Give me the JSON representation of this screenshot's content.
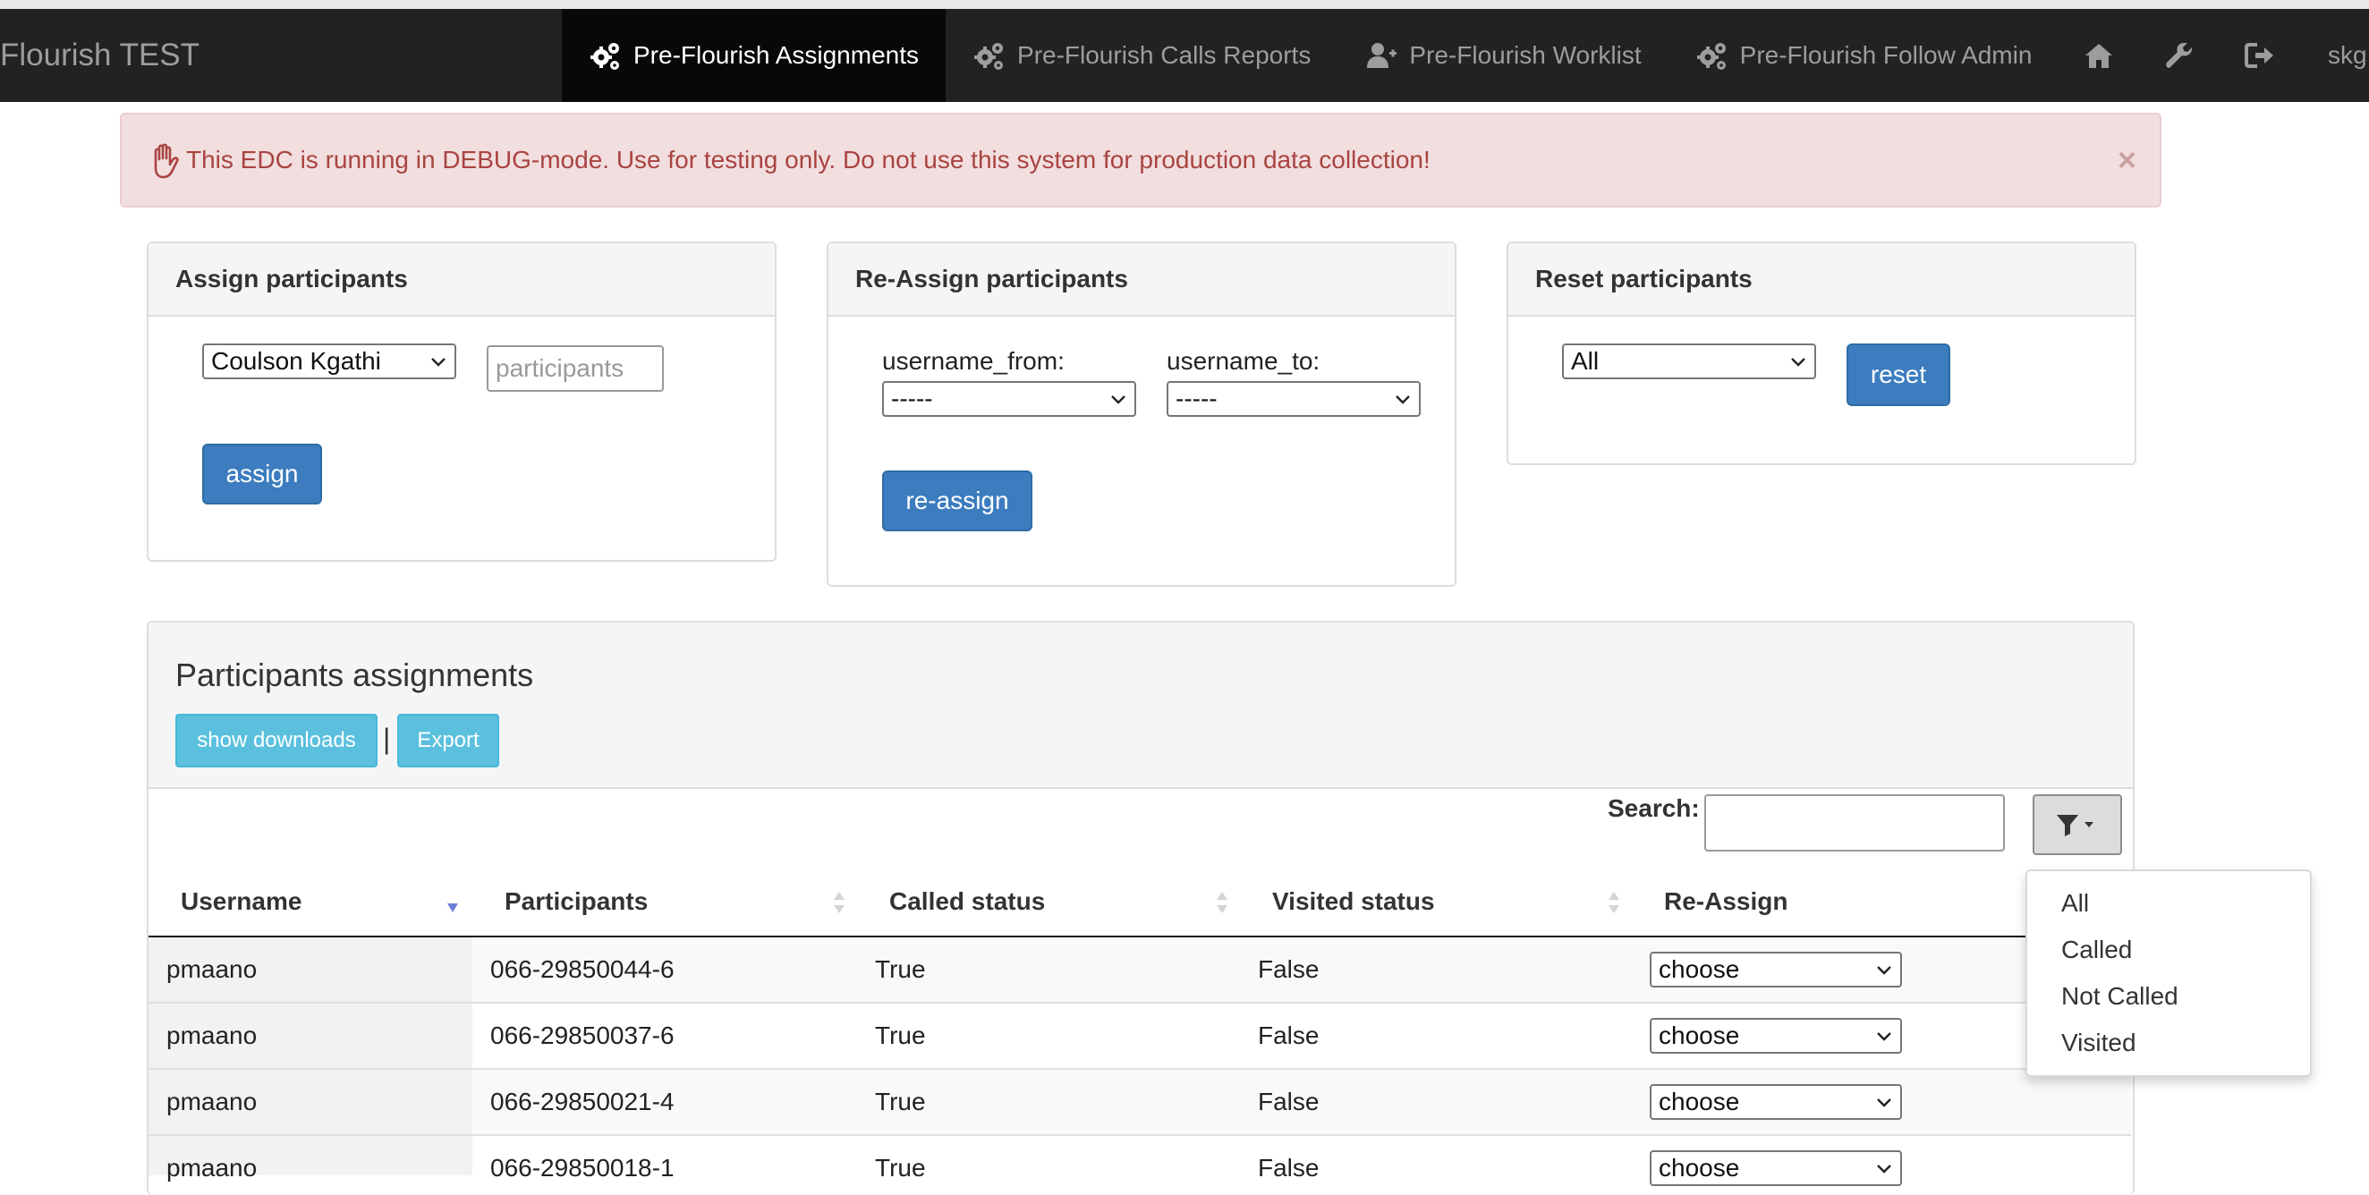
{
  "brand": "Flourish TEST",
  "nav": {
    "items": [
      {
        "label": "Pre-Flourish Assignments",
        "icon": "gears-icon"
      },
      {
        "label": "Pre-Flourish Calls Reports",
        "icon": "gears-icon"
      },
      {
        "label": "Pre-Flourish Worklist",
        "icon": "user-plus-icon"
      },
      {
        "label": "Pre-Flourish Follow Admin",
        "icon": "gears-icon"
      }
    ],
    "user": "skg"
  },
  "alert": {
    "text": "This EDC is running in DEBUG-mode. Use for testing only. Do not use this system for production data collection!",
    "close": "×"
  },
  "assign": {
    "title": "Assign participants",
    "user_select": "Coulson Kgathi",
    "participants_placeholder": "participants",
    "button": "assign"
  },
  "reassign": {
    "title": "Re-Assign participants",
    "from_label": "username_from:",
    "to_label": "username_to:",
    "from_value": "-----",
    "to_value": "-----",
    "button": "re-assign"
  },
  "reset": {
    "title": "Reset participants",
    "select_value": "All",
    "button": "reset"
  },
  "assignments": {
    "title": "Participants assignments",
    "show_downloads": "show downloads",
    "separator": "|",
    "export": "Export",
    "search_label": "Search:",
    "columns": [
      "Username",
      "Participants",
      "Called status",
      "Visited status",
      "Re-Assign"
    ],
    "rows": [
      {
        "username": "pmaano",
        "participant": "066-29850044-6",
        "called": "True",
        "visited": "False",
        "reassign": "choose"
      },
      {
        "username": "pmaano",
        "participant": "066-29850037-6",
        "called": "True",
        "visited": "False",
        "reassign": "choose"
      },
      {
        "username": "pmaano",
        "participant": "066-29850021-4",
        "called": "True",
        "visited": "False",
        "reassign": "choose"
      },
      {
        "username": "pmaano",
        "participant": "066-29850018-1",
        "called": "True",
        "visited": "False",
        "reassign": "choose"
      }
    ]
  },
  "filter_menu": [
    "All",
    "Called",
    "Not Called",
    "Visited"
  ],
  "colors": {
    "navbar": "#222222",
    "primary": "#3c7cbf",
    "info": "#5bc0de",
    "alert_bg": "#f2dede",
    "alert_text": "#a94442"
  }
}
